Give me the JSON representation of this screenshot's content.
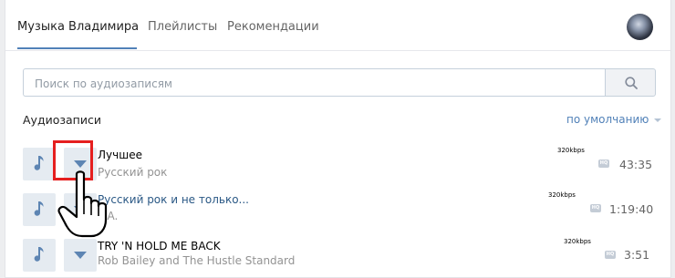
{
  "tabs": [
    {
      "label": "Музыка Владимира",
      "active": true
    },
    {
      "label": "Плейлисты",
      "active": false
    },
    {
      "label": "Рекомендации",
      "active": false
    }
  ],
  "search": {
    "placeholder": "Поиск по аудиозаписям",
    "value": ""
  },
  "section": {
    "title": "Аудиозаписи",
    "sort_label": "по умолчанию"
  },
  "tracks": [
    {
      "title": "Лучшее",
      "artist": "Русский рок",
      "bitrate": "320kbps",
      "quality_badge": "HQ",
      "duration": "43:35"
    },
    {
      "title": "Русский рок и не только...",
      "artist": "V.A.",
      "bitrate": "320kbps",
      "quality_badge": "HQ",
      "duration": "1:19:40"
    },
    {
      "title": "TRY 'N HOLD ME BACK",
      "artist": "Rob Bailey and The Hustle Standard",
      "bitrate": "320kbps",
      "quality_badge": "HQ",
      "duration": "3:51"
    }
  ],
  "colors": {
    "accent": "#5181b8",
    "highlight": "#e51f1f",
    "button_bg": "#e5ebf1"
  },
  "icons": [
    "music-note-icon",
    "chevron-down-icon",
    "search-icon",
    "hand-pointer-icon"
  ]
}
